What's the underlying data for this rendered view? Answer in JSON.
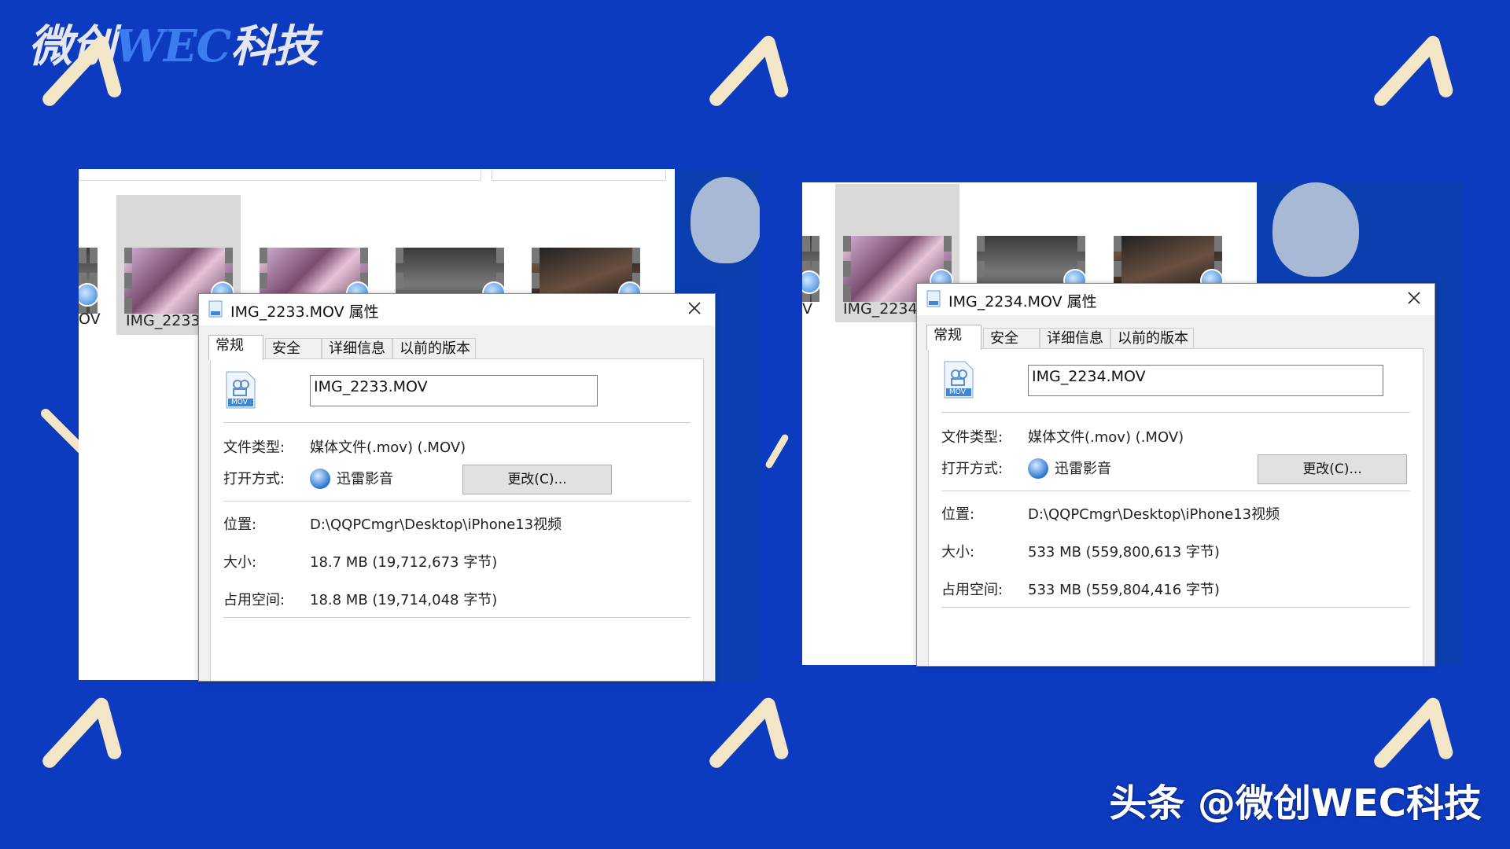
{
  "logo": {
    "part1": "微创",
    "part2": "WEC",
    "part3": "科技"
  },
  "watermark": "头条 @微创WEC科技",
  "left": {
    "thumb_label_partial_left": "OV",
    "thumb_label": "IMG_2233.",
    "dialog": {
      "title": "IMG_2233.MOV 属性",
      "tabs": [
        "常规",
        "安全",
        "详细信息",
        "以前的版本"
      ],
      "active_tab": "常规",
      "file_icon_text": "MOV",
      "filename": "IMG_2233.MOV",
      "file_type_label": "文件类型:",
      "file_type_value": "媒体文件(.mov) (.MOV)",
      "open_with_label": "打开方式:",
      "open_with_app": "迅雷影音",
      "change_button": "更改(C)...",
      "location_label": "位置:",
      "location_value": "D:\\QQPCmgr\\Desktop\\iPhone13视频",
      "size_label": "大小:",
      "size_value": "18.7 MB (19,712,673 字节)",
      "disk_label": "占用空间:",
      "disk_value": "18.8 MB (19,714,048 字节)"
    }
  },
  "right": {
    "thumb_label_partial_left": "V",
    "thumb_label": "IMG_2234.",
    "dialog": {
      "title": "IMG_2234.MOV 属性",
      "tabs": [
        "常规",
        "安全",
        "详细信息",
        "以前的版本"
      ],
      "active_tab": "常规",
      "file_icon_text": "MOV",
      "filename": "IMG_2234.MOV",
      "file_type_label": "文件类型:",
      "file_type_value": "媒体文件(.mov) (.MOV)",
      "open_with_label": "打开方式:",
      "open_with_app": "迅雷影音",
      "change_button": "更改(C)...",
      "location_label": "位置:",
      "location_value": "D:\\QQPCmgr\\Desktop\\iPhone13视频",
      "size_label": "大小:",
      "size_value": "533 MB (559,800,613 字节)",
      "disk_label": "占用空间:",
      "disk_value": "533 MB (559,804,416 字节)"
    }
  },
  "colors": {
    "background": "#0d3bbf",
    "chevron": "#f2e6c6",
    "dialog": "#f0f0f0"
  }
}
